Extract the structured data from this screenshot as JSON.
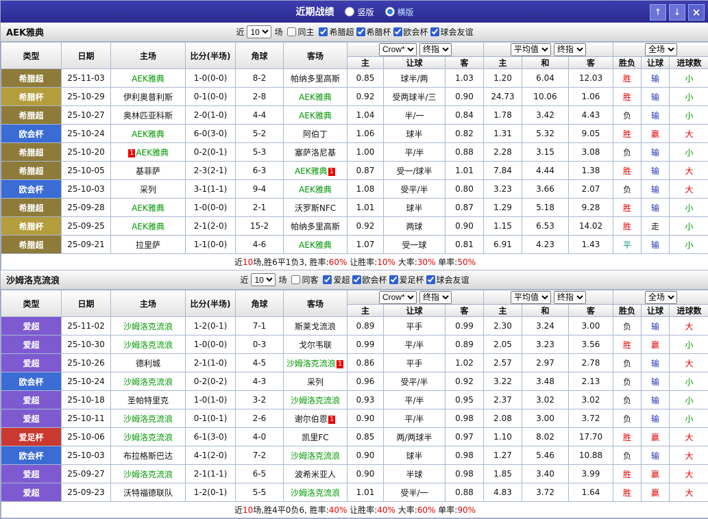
{
  "titlebar": {
    "title": "近期战绩",
    "layout_options": [
      {
        "label": "竖版",
        "selected": false
      },
      {
        "label": "横版",
        "selected": true
      }
    ],
    "up_icon": "↑",
    "down_icon": "↓",
    "close_icon": "×"
  },
  "controls": {
    "recent_label": "近",
    "recent_value": "10",
    "games_label": "场",
    "bookmaker": "Crow*",
    "final_odds": "终指",
    "average": "平均值",
    "full_match": "全场"
  },
  "columns": {
    "type": "类型",
    "date": "日期",
    "home": "主场",
    "score": "比分(半场)",
    "corner": "角球",
    "away": "客场",
    "ah_home": "主",
    "ah_line": "让球",
    "ah_away": "客",
    "eu_home": "主",
    "eu_draw": "和",
    "eu_away": "客",
    "res_wdl": "胜负",
    "res_handicap": "让球",
    "res_goals": "进球数"
  },
  "colors": {
    "greek_super": "#8e7b39",
    "greek_cup": "#b49d3c",
    "conference_league": "#3a6cd4",
    "irish_premier": "#7e5ad0",
    "irish_cup": "#c9392f",
    "win_text": "#e60000",
    "draw_text": "#009988",
    "handicap_lose_text": "#2233bb",
    "goals_under_text": "#009900",
    "focus_team_text": "#009900",
    "titlebar_bg": "#32329e"
  },
  "sections": [
    {
      "team": "AEK雅典",
      "filter": {
        "same_side": "同主",
        "leagues": [
          "希腊超",
          "希腊杯",
          "欧会杯",
          "球会友谊"
        ]
      },
      "rows": [
        {
          "league": "希腊超",
          "lc": "lg-gsl",
          "date": "25-11-03",
          "home": {
            "n": "AEK雅典",
            "f": 1
          },
          "score": "1-0(0-0)",
          "corner": "8-2",
          "away": {
            "n": "帕纳多里高斯"
          },
          "ah": [
            "0.85",
            "球半/两",
            "1.03"
          ],
          "eu": [
            "1.20",
            "6.04",
            "12.03"
          ],
          "res": [
            [
              "胜",
              "r"
            ],
            [
              "输",
              "b"
            ],
            [
              "小",
              "g"
            ]
          ]
        },
        {
          "league": "希腊杯",
          "lc": "lg-gcup",
          "date": "25-10-29",
          "home": {
            "n": "伊利奥普利斯"
          },
          "score": "0-1(0-0)",
          "corner": "2-8",
          "away": {
            "n": "AEK雅典",
            "f": 1
          },
          "ah": [
            "0.92",
            "受两球半/三",
            "0.90"
          ],
          "eu": [
            "24.73",
            "10.06",
            "1.06"
          ],
          "res": [
            [
              "胜",
              "r"
            ],
            [
              "输",
              "b"
            ],
            [
              "小",
              "g"
            ]
          ]
        },
        {
          "league": "希腊超",
          "lc": "lg-gsl",
          "date": "25-10-27",
          "home": {
            "n": "奥林匹亚科斯"
          },
          "score": "2-0(1-0)",
          "corner": "4-4",
          "away": {
            "n": "AEK雅典",
            "f": 1
          },
          "ah": [
            "1.04",
            "半/一",
            "0.84"
          ],
          "eu": [
            "1.78",
            "3.42",
            "4.43"
          ],
          "res": [
            [
              "负",
              "k"
            ],
            [
              "输",
              "b"
            ],
            [
              "小",
              "g"
            ]
          ]
        },
        {
          "league": "欧会杯",
          "lc": "lg-uecl",
          "date": "25-10-24",
          "home": {
            "n": "AEK雅典",
            "f": 1
          },
          "score": "6-0(3-0)",
          "corner": "5-2",
          "away": {
            "n": "阿伯丁"
          },
          "ah": [
            "1.06",
            "球半",
            "0.82"
          ],
          "eu": [
            "1.31",
            "5.32",
            "9.05"
          ],
          "res": [
            [
              "胜",
              "r"
            ],
            [
              "赢",
              "r"
            ],
            [
              "大",
              "r"
            ]
          ]
        },
        {
          "league": "希腊超",
          "lc": "lg-gsl",
          "date": "25-10-20",
          "home": {
            "n": "AEK雅典",
            "f": 1,
            "bp": "1"
          },
          "score": "0-2(0-1)",
          "corner": "5-3",
          "away": {
            "n": "塞萨洛尼基"
          },
          "ah": [
            "1.00",
            "平/半",
            "0.88"
          ],
          "eu": [
            "2.28",
            "3.15",
            "3.08"
          ],
          "res": [
            [
              "负",
              "k"
            ],
            [
              "输",
              "b"
            ],
            [
              "小",
              "g"
            ]
          ]
        },
        {
          "league": "希腊超",
          "lc": "lg-gsl",
          "date": "25-10-05",
          "home": {
            "n": "基菲萨"
          },
          "score": "2-3(2-1)",
          "corner": "6-3",
          "away": {
            "n": "AEK雅典",
            "f": 1,
            "ba": "1"
          },
          "ah": [
            "0.87",
            "受一/球半",
            "1.01"
          ],
          "eu": [
            "7.84",
            "4.44",
            "1.38"
          ],
          "res": [
            [
              "胜",
              "r"
            ],
            [
              "输",
              "b"
            ],
            [
              "大",
              "r"
            ]
          ]
        },
        {
          "league": "欧会杯",
          "lc": "lg-uecl",
          "date": "25-10-03",
          "home": {
            "n": "采列"
          },
          "score": "3-1(1-1)",
          "corner": "9-4",
          "away": {
            "n": "AEK雅典",
            "f": 1
          },
          "ah": [
            "1.08",
            "受平/半",
            "0.80"
          ],
          "eu": [
            "3.23",
            "3.66",
            "2.07"
          ],
          "res": [
            [
              "负",
              "k"
            ],
            [
              "输",
              "b"
            ],
            [
              "大",
              "r"
            ]
          ]
        },
        {
          "league": "希腊超",
          "lc": "lg-gsl",
          "date": "25-09-28",
          "home": {
            "n": "AEK雅典",
            "f": 1
          },
          "score": "1-0(0-0)",
          "corner": "2-1",
          "away": {
            "n": "沃罗斯NFC"
          },
          "ah": [
            "1.01",
            "球半",
            "0.87"
          ],
          "eu": [
            "1.29",
            "5.18",
            "9.28"
          ],
          "res": [
            [
              "胜",
              "r"
            ],
            [
              "输",
              "b"
            ],
            [
              "小",
              "g"
            ]
          ]
        },
        {
          "league": "希腊杯",
          "lc": "lg-gcup",
          "date": "25-09-25",
          "home": {
            "n": "AEK雅典",
            "f": 1
          },
          "score": "2-1(2-0)",
          "corner": "15-2",
          "away": {
            "n": "帕纳多里高斯"
          },
          "ah": [
            "0.92",
            "两球",
            "0.90"
          ],
          "eu": [
            "1.15",
            "6.53",
            "14.02"
          ],
          "res": [
            [
              "胜",
              "r"
            ],
            [
              "走",
              "k"
            ],
            [
              "小",
              "g"
            ]
          ]
        },
        {
          "league": "希腊超",
          "lc": "lg-gsl",
          "date": "25-09-21",
          "home": {
            "n": "拉里萨"
          },
          "score": "1-1(0-0)",
          "corner": "4-6",
          "away": {
            "n": "AEK雅典",
            "f": 1
          },
          "ah": [
            "1.07",
            "受一球",
            "0.81"
          ],
          "eu": [
            "6.91",
            "4.23",
            "1.43"
          ],
          "res": [
            [
              "平",
              "t"
            ],
            [
              "输",
              "b"
            ],
            [
              "小",
              "g"
            ]
          ]
        }
      ],
      "summary": [
        {
          "t": "近"
        },
        {
          "t": "10",
          "red": true
        },
        {
          "t": "场,胜6平1负3, 胜率:"
        },
        {
          "t": "60%",
          "red": true
        },
        {
          "t": " 让胜率:"
        },
        {
          "t": "10%",
          "red": true
        },
        {
          "t": " 大率:"
        },
        {
          "t": "30%",
          "red": true
        },
        {
          "t": " 单率:"
        },
        {
          "t": "50%",
          "red": true
        }
      ]
    },
    {
      "team": "沙姆洛克流浪",
      "filter": {
        "same_side": "同客",
        "leagues": [
          "爱超",
          "欧会杯",
          "爱足杯",
          "球会友谊"
        ]
      },
      "rows": [
        {
          "league": "爱超",
          "lc": "lg-ipl",
          "date": "25-11-02",
          "home": {
            "n": "沙姆洛克流浪",
            "f": 1
          },
          "score": "1-2(0-1)",
          "corner": "7-1",
          "away": {
            "n": "斯莱戈流浪"
          },
          "ah": [
            "0.89",
            "平手",
            "0.99"
          ],
          "eu": [
            "2.30",
            "3.24",
            "3.00"
          ],
          "res": [
            [
              "负",
              "k"
            ],
            [
              "输",
              "b"
            ],
            [
              "大",
              "r"
            ]
          ]
        },
        {
          "league": "爱超",
          "lc": "lg-ipl",
          "date": "25-10-30",
          "home": {
            "n": "沙姆洛克流浪",
            "f": 1
          },
          "score": "1-0(0-0)",
          "corner": "0-3",
          "away": {
            "n": "戈尔韦联"
          },
          "ah": [
            "0.99",
            "平/半",
            "0.89"
          ],
          "eu": [
            "2.05",
            "3.23",
            "3.56"
          ],
          "res": [
            [
              "胜",
              "r"
            ],
            [
              "赢",
              "r"
            ],
            [
              "小",
              "g"
            ]
          ]
        },
        {
          "league": "爱超",
          "lc": "lg-ipl",
          "date": "25-10-26",
          "home": {
            "n": "德利城"
          },
          "score": "2-1(1-0)",
          "corner": "4-5",
          "away": {
            "n": "沙姆洛克流浪",
            "f": 1,
            "ba": "1"
          },
          "ah": [
            "0.86",
            "平手",
            "1.02"
          ],
          "eu": [
            "2.57",
            "2.97",
            "2.78"
          ],
          "res": [
            [
              "负",
              "k"
            ],
            [
              "输",
              "b"
            ],
            [
              "大",
              "r"
            ]
          ]
        },
        {
          "league": "欧会杯",
          "lc": "lg-uecl",
          "date": "25-10-24",
          "home": {
            "n": "沙姆洛克流浪",
            "f": 1
          },
          "score": "0-2(0-2)",
          "corner": "4-3",
          "away": {
            "n": "采列"
          },
          "ah": [
            "0.96",
            "受平/半",
            "0.92"
          ],
          "eu": [
            "3.22",
            "3.48",
            "2.13"
          ],
          "res": [
            [
              "负",
              "k"
            ],
            [
              "输",
              "b"
            ],
            [
              "小",
              "g"
            ]
          ]
        },
        {
          "league": "爱超",
          "lc": "lg-ipl",
          "date": "25-10-18",
          "home": {
            "n": "圣帕特里克"
          },
          "score": "1-0(1-0)",
          "corner": "3-2",
          "away": {
            "n": "沙姆洛克流浪",
            "f": 1
          },
          "ah": [
            "0.93",
            "平/半",
            "0.95"
          ],
          "eu": [
            "2.37",
            "3.02",
            "3.02"
          ],
          "res": [
            [
              "负",
              "k"
            ],
            [
              "输",
              "b"
            ],
            [
              "小",
              "g"
            ]
          ]
        },
        {
          "league": "爱超",
          "lc": "lg-ipl",
          "date": "25-10-11",
          "home": {
            "n": "沙姆洛克流浪",
            "f": 1
          },
          "score": "0-1(0-1)",
          "corner": "2-6",
          "away": {
            "n": "谢尔伯恩",
            "ba": "1"
          },
          "ah": [
            "0.90",
            "平/半",
            "0.98"
          ],
          "eu": [
            "2.08",
            "3.00",
            "3.72"
          ],
          "res": [
            [
              "负",
              "k"
            ],
            [
              "输",
              "b"
            ],
            [
              "小",
              "g"
            ]
          ]
        },
        {
          "league": "爱足杯",
          "lc": "lg-icup",
          "date": "25-10-06",
          "home": {
            "n": "沙姆洛克流浪",
            "f": 1
          },
          "score": "6-1(3-0)",
          "corner": "4-0",
          "away": {
            "n": "凯里FC"
          },
          "ah": [
            "0.85",
            "两/两球半",
            "0.97"
          ],
          "eu": [
            "1.10",
            "8.02",
            "17.70"
          ],
          "res": [
            [
              "胜",
              "r"
            ],
            [
              "赢",
              "r"
            ],
            [
              "大",
              "r"
            ]
          ]
        },
        {
          "league": "欧会杯",
          "lc": "lg-uecl",
          "date": "25-10-03",
          "home": {
            "n": "布拉格斯巴达"
          },
          "score": "4-1(2-0)",
          "corner": "7-2",
          "away": {
            "n": "沙姆洛克流浪",
            "f": 1
          },
          "ah": [
            "0.90",
            "球半",
            "0.98"
          ],
          "eu": [
            "1.27",
            "5.46",
            "10.88"
          ],
          "res": [
            [
              "负",
              "k"
            ],
            [
              "输",
              "b"
            ],
            [
              "大",
              "r"
            ]
          ]
        },
        {
          "league": "爱超",
          "lc": "lg-ipl",
          "date": "25-09-27",
          "home": {
            "n": "沙姆洛克流浪",
            "f": 1
          },
          "score": "2-1(1-1)",
          "corner": "6-5",
          "away": {
            "n": "波希米亚人"
          },
          "ah": [
            "0.90",
            "半球",
            "0.98"
          ],
          "eu": [
            "1.85",
            "3.40",
            "3.99"
          ],
          "res": [
            [
              "胜",
              "r"
            ],
            [
              "赢",
              "r"
            ],
            [
              "大",
              "r"
            ]
          ]
        },
        {
          "league": "爱超",
          "lc": "lg-ipl",
          "date": "25-09-23",
          "home": {
            "n": "沃特福德联队"
          },
          "score": "1-2(0-1)",
          "corner": "5-5",
          "away": {
            "n": "沙姆洛克流浪",
            "f": 1
          },
          "ah": [
            "1.01",
            "受半/一",
            "0.88"
          ],
          "eu": [
            "4.83",
            "3.72",
            "1.64"
          ],
          "res": [
            [
              "胜",
              "r"
            ],
            [
              "赢",
              "r"
            ],
            [
              "大",
              "r"
            ]
          ]
        }
      ],
      "summary": [
        {
          "t": "近"
        },
        {
          "t": "10",
          "red": true
        },
        {
          "t": "场,胜4平0负6, 胜率:"
        },
        {
          "t": "40%",
          "red": true
        },
        {
          "t": " 让胜率:"
        },
        {
          "t": "40%",
          "red": true
        },
        {
          "t": " 大率:"
        },
        {
          "t": "60%",
          "red": true
        },
        {
          "t": " 单率:"
        },
        {
          "t": "90%",
          "red": true
        }
      ]
    }
  ]
}
